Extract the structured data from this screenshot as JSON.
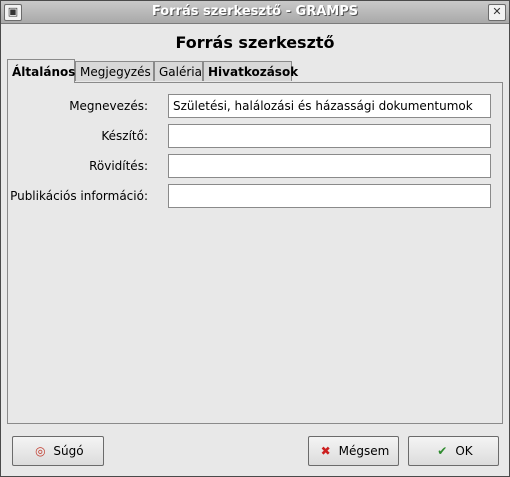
{
  "window": {
    "title": "Forrás szerkesztő - GRAMPS"
  },
  "heading": "Forrás szerkesztő",
  "tabs": [
    {
      "label": "Általános"
    },
    {
      "label": "Megjegyzés"
    },
    {
      "label": "Galéria"
    },
    {
      "label": "Hivatkozások"
    }
  ],
  "form": {
    "name_label": "Megnevezés:",
    "name_value": "Születési, halálozási és házassági dokumentumok",
    "author_label": "Készítő:",
    "author_value": "",
    "abbrev_label": "Rövidítés:",
    "abbrev_value": "",
    "pubinfo_label": "Publikációs információ:",
    "pubinfo_value": ""
  },
  "buttons": {
    "help": "Súgó",
    "cancel": "Mégsem",
    "ok": "OK"
  },
  "icons": {
    "help": "lifebuoy-icon",
    "cancel": "red-x-icon",
    "ok": "green-check-icon"
  }
}
